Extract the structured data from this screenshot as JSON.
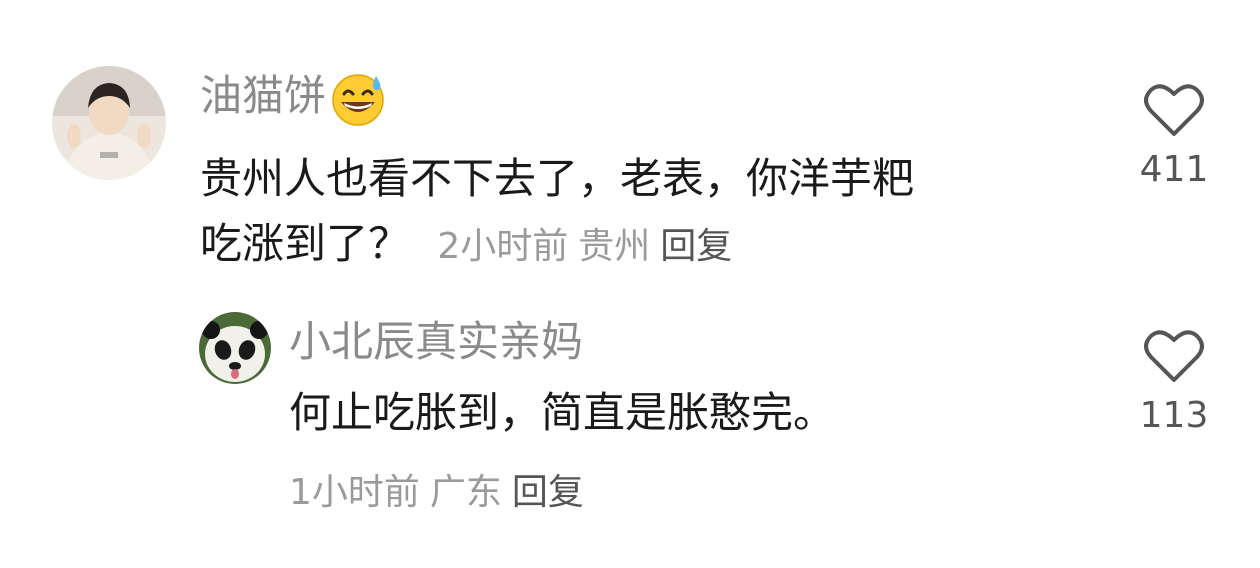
{
  "comments": [
    {
      "username": "油猫饼",
      "text_line1": "贵州人也看不下去了，老表，你洋芋粑",
      "text_line2": "吃涨到了？",
      "time": "2小时前",
      "location": "贵州",
      "reply_label": "回复",
      "likes": "411",
      "username_emoji": "grinning-sweat-emoji"
    },
    {
      "username": "小北辰真实亲妈",
      "text": "何止吃胀到，简直是胀憨完。",
      "time": "1小时前",
      "location": "广东",
      "reply_label": "回复",
      "likes": "113"
    }
  ]
}
